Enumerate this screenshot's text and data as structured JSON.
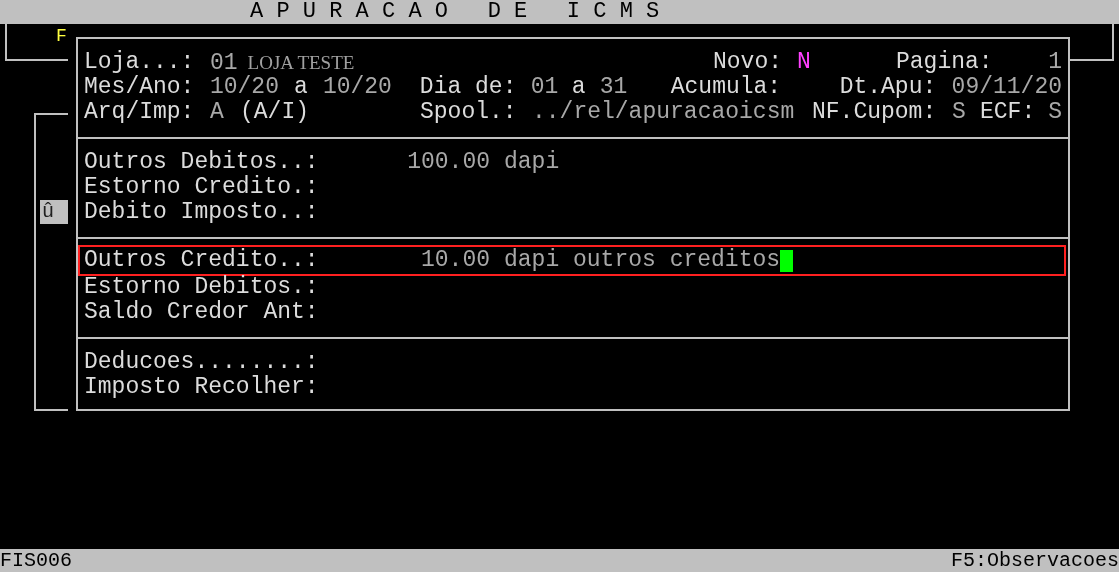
{
  "title": "A P U R A C A O   D E   I C M S",
  "side_marks": {
    "top": "F",
    "left": "û"
  },
  "header": {
    "loja": {
      "label": "Loja...:",
      "code": "01",
      "name": "LOJA TESTE"
    },
    "novo": {
      "label": "Novo:",
      "value": "N"
    },
    "pagina": {
      "label": "Pagina:",
      "value": "1"
    },
    "mes_ano": {
      "label": "Mes/Ano:",
      "from": "10/20",
      "sep": "a",
      "to": "10/20"
    },
    "dia": {
      "label": "Dia de:",
      "from": "01",
      "sep": "a",
      "to": "31"
    },
    "acumula": {
      "label": "Acumula:"
    },
    "dt_apu": {
      "label": "Dt.Apu:",
      "value": "09/11/20"
    },
    "arq_imp": {
      "label": "Arq/Imp:",
      "value": "A",
      "hint": "(A/I)"
    },
    "spool": {
      "label": "Spool.:",
      "value": "../rel/apuracaoicsm"
    },
    "nf_cupom": {
      "label": "NF.Cupom:",
      "value": "S"
    },
    "ecf": {
      "label": "ECF:",
      "value": "S"
    }
  },
  "sections": [
    [
      {
        "label": "Outros Debitos..:",
        "amount": "100.00",
        "note": "dapi",
        "focused": false
      },
      {
        "label": "Estorno Credito.:",
        "focused": false
      },
      {
        "label": "Debito Imposto..:",
        "focused": false
      }
    ],
    [
      {
        "label": "Outros Credito..:",
        "amount": "10.00",
        "note": "dapi outros creditos",
        "focused": true
      },
      {
        "label": "Estorno Debitos.:",
        "focused": false
      },
      {
        "label": "Saldo Credor Ant:",
        "focused": false
      }
    ],
    [
      {
        "label": "Deducoes........:",
        "focused": false
      },
      {
        "label": "Imposto Recolher:",
        "focused": false
      }
    ]
  ],
  "status_bar": {
    "left": "FIS006",
    "right": "F5:Observacoes"
  }
}
